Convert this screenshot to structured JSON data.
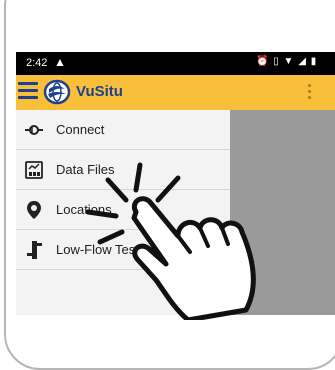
{
  "status_bar": {
    "time": "2:42",
    "warning_icon": "warning-triangle-icon",
    "right_icons": [
      "alarm-icon",
      "vibrate-icon",
      "wifi-icon",
      "signal-icon",
      "battery-icon"
    ]
  },
  "app_bar": {
    "title": "VuSitu",
    "menu_icon": "hamburger-menu-icon",
    "logo_icon": "vusitu-logo-icon",
    "more_icon": "overflow-menu-icon",
    "color": "#f9bf3b",
    "title_color": "#1f3f8f"
  },
  "drawer": {
    "items": [
      {
        "label": "Connect",
        "icon": "connect-icon"
      },
      {
        "label": "Data Files",
        "icon": "data-files-icon"
      },
      {
        "label": "Locations",
        "icon": "location-pin-icon"
      },
      {
        "label": "Low-Flow Testing",
        "icon": "low-flow-icon"
      }
    ]
  },
  "gesture": {
    "icon": "tap-hand-icon"
  }
}
